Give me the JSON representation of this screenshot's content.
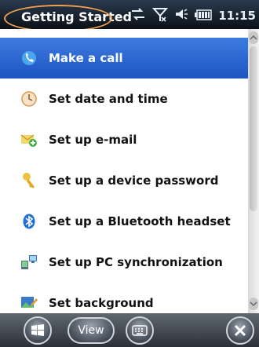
{
  "titlebar": {
    "title": "Getting Started",
    "clock": "11:15",
    "status_icons": [
      "data-sync-icon",
      "no-signal-icon",
      "volume-icon",
      "battery-icon"
    ]
  },
  "list": {
    "items": [
      {
        "label": "Make a call",
        "icon": "phone-icon",
        "selected": true
      },
      {
        "label": "Set date and time",
        "icon": "clock-icon",
        "selected": false
      },
      {
        "label": "Set up e-mail",
        "icon": "email-icon",
        "selected": false
      },
      {
        "label": "Set up a device password",
        "icon": "key-icon",
        "selected": false
      },
      {
        "label": "Set up a Bluetooth headset",
        "icon": "bluetooth-icon",
        "selected": false
      },
      {
        "label": "Set up PC synchronization",
        "icon": "pc-sync-icon",
        "selected": false
      },
      {
        "label": "Set background",
        "icon": "background-icon",
        "selected": false
      }
    ]
  },
  "bottombar": {
    "start_icon": "windows-start-icon",
    "view_label": "View",
    "keyboard_icon": "keyboard-icon",
    "close_icon": "close-icon"
  },
  "colors": {
    "selection": "#2a64cf",
    "title_highlight": "#f0a050"
  }
}
